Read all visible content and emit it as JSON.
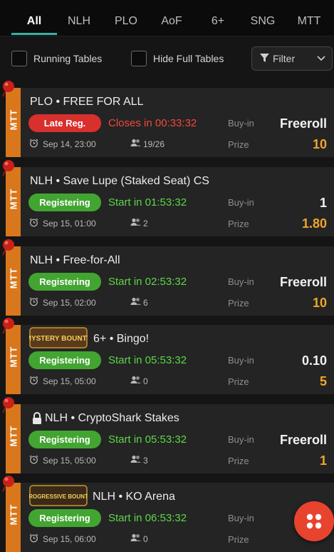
{
  "tabs": [
    "All",
    "NLH",
    "PLO",
    "AoF",
    "6+",
    "SNG",
    "MTT"
  ],
  "filters": {
    "running_tables": "Running Tables",
    "hide_full_tables": "Hide Full Tables",
    "filter_label": "Filter"
  },
  "labels": {
    "buyin": "Buy-in",
    "prize": "Prize"
  },
  "logos": {
    "mystery_bounty": "MYSTERY BOUNTY",
    "progressive_bounty": "PROGRESSIVE BOUNTY"
  },
  "tournaments": [
    {
      "type": "MTT",
      "title": "PLO • FREE FOR ALL",
      "status": "Late Reg.",
      "timer": "Closes in 00:33:32",
      "date": "Sep 14, 23:00",
      "players": "19/26",
      "buyin": "Freeroll",
      "prize": "10"
    },
    {
      "type": "MTT",
      "title": "NLH • Save Lupe (Staked Seat) CS",
      "status": "Registering",
      "timer": "Start in 01:53:32",
      "date": "Sep 15, 01:00",
      "players": "2",
      "buyin": "1",
      "prize": "1.80"
    },
    {
      "type": "MTT",
      "title": "NLH • Free-for-All",
      "status": "Registering",
      "timer": "Start in 02:53:32",
      "date": "Sep 15, 02:00",
      "players": "6",
      "buyin": "Freeroll",
      "prize": "10"
    },
    {
      "type": "MTT",
      "title": "6+ • Bingo!",
      "status": "Registering",
      "timer": "Start in 05:53:32",
      "date": "Sep 15, 05:00",
      "players": "0",
      "buyin": "0.10",
      "prize": "5"
    },
    {
      "type": "MTT",
      "title": "NLH • CryptoShark Stakes",
      "status": "Registering",
      "timer": "Start in 05:53:32",
      "date": "Sep 15, 05:00",
      "players": "3",
      "buyin": "Freeroll",
      "prize": "1"
    },
    {
      "type": "MTT",
      "title": "NLH • KO Arena",
      "status": "Registering",
      "timer": "Start in 06:53:32",
      "date": "Sep 15, 06:00",
      "players": "0",
      "buyin": "",
      "prize": ""
    }
  ]
}
